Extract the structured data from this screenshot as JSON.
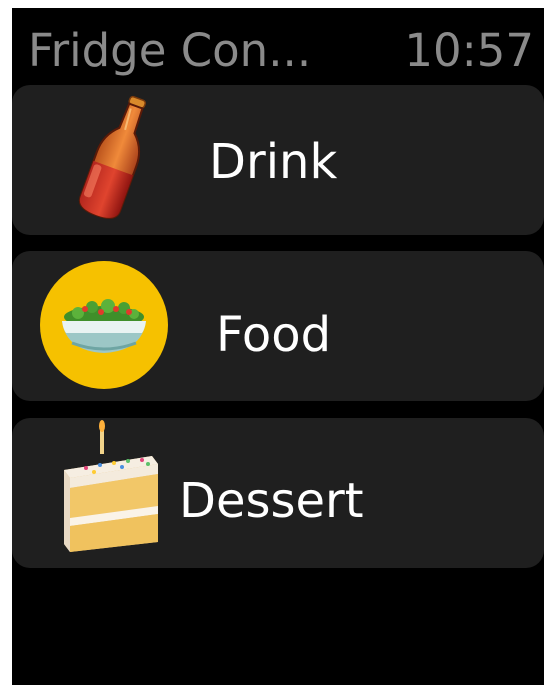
{
  "status_bar": {
    "app_title": "Fridge Con...",
    "time": "10:57"
  },
  "menu": {
    "items": [
      {
        "label": "Drink",
        "icon": "bottle-icon"
      },
      {
        "label": "Food",
        "icon": "salad-bowl-icon"
      },
      {
        "label": "Dessert",
        "icon": "cake-slice-icon"
      }
    ]
  },
  "colors": {
    "background": "#000000",
    "row_background": "#1f1f1f",
    "title_text": "#8a8a8a",
    "label_text": "#ffffff",
    "food_icon_circle": "#f6c100"
  }
}
